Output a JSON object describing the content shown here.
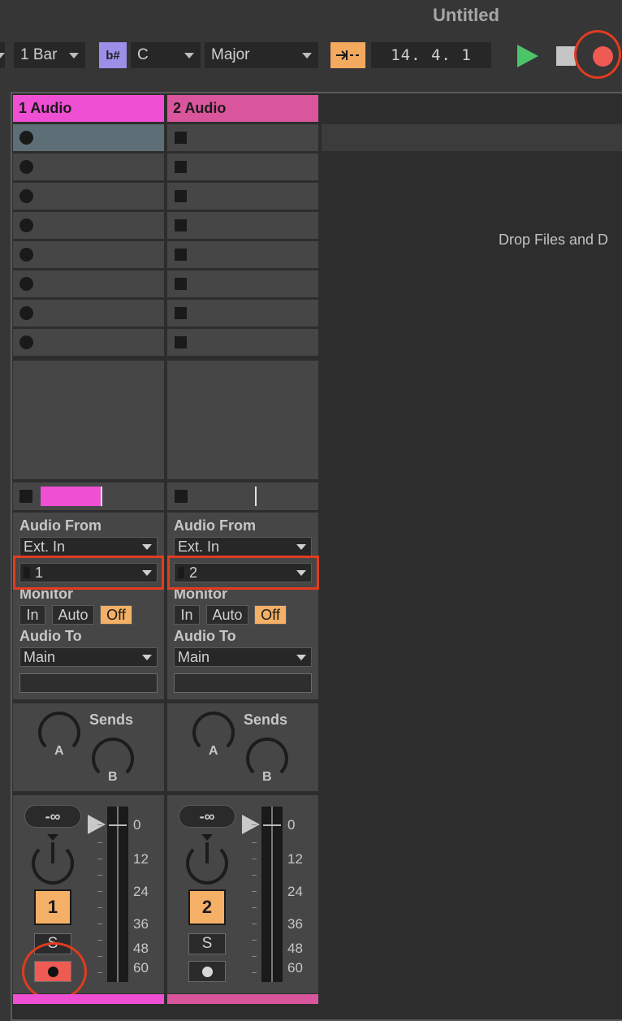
{
  "window": {
    "title": "Untitled"
  },
  "toolbar": {
    "quantize": "1 Bar",
    "key_icon": "b#",
    "key_root": "C",
    "scale": "Major",
    "position": "14.  4.  1"
  },
  "colors": {
    "track1": "#ee4fd3",
    "track2": "#d9569c",
    "record": "#ef5a52",
    "play": "#4cc46a",
    "accent": "#f3aa5f"
  },
  "tracks": [
    {
      "name": "1 Audio",
      "input_label": "Audio From",
      "input_type": "Ext. In",
      "input_channel": "1",
      "monitor_label": "Monitor",
      "monitor": [
        "In",
        "Auto",
        "Off"
      ],
      "output_label": "Audio To",
      "output": "Main",
      "sends_label": "Sends",
      "send_a": "A",
      "send_b": "B",
      "volume": "-∞",
      "number": "1",
      "solo": "S",
      "armed": true
    },
    {
      "name": "2 Audio",
      "input_label": "Audio From",
      "input_type": "Ext. In",
      "input_channel": "2",
      "monitor_label": "Monitor",
      "monitor": [
        "In",
        "Auto",
        "Off"
      ],
      "output_label": "Audio To",
      "output": "Main",
      "sends_label": "Sends",
      "send_a": "A",
      "send_b": "B",
      "volume": "-∞",
      "number": "2",
      "solo": "S",
      "armed": false
    }
  ],
  "meter_scale": [
    "0",
    "12",
    "24",
    "36",
    "48",
    "60"
  ],
  "drop_area": {
    "text": "Drop Files and D"
  }
}
